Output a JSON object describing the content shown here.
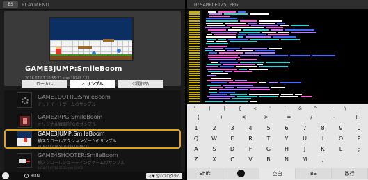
{
  "playmenu": {
    "menu_badge": "ES",
    "title": "PLAYMENU",
    "selected_game": {
      "title": "GAME3JUMP:SmileBoom",
      "meta": "2016.07.07  10:55:21   size 10748 / 21"
    },
    "tabs": [
      {
        "label": "ローカル",
        "active": false
      },
      {
        "label": "✓ サンプル",
        "active": true
      },
      {
        "label": "公開作品",
        "active": false
      }
    ],
    "list": [
      {
        "name": "GAME1DOTRC:SmileBoom",
        "desc": "ドットイートゲームのサンプル",
        "date": "2016.07.07  10:55:21  size 8120"
      },
      {
        "name": "GAME2RPG:SmileBoom",
        "desc": "オリジナル戦闘RPGのサンプル",
        "date": "2016.07.07  10:55:21  size 9841"
      },
      {
        "name": "GAME3JUMP:SmileBoom",
        "desc": "横スクロールアクションゲームのサンプル",
        "date": "2016.07.07  10:55:21  size 10748 / 21",
        "selected": true
      },
      {
        "name": "GAME4SHOOTER:SmileBoom",
        "desc": "横スクロールシューティングゲームのサンプル",
        "date": "2016.07.07  10:55:21  size 12003"
      }
    ],
    "footer": {
      "run_label": "RUN",
      "help_label": "◁ ▼ 短いプログラム"
    }
  },
  "editor": {
    "file_title": "0:SAMPLE125.PRG",
    "code_colors": {
      "comment": "#2fd3d3",
      "keyword": "#ffffff",
      "string": "#ff5fd7",
      "number": "#b27bff",
      "plain": "#3f6bff"
    }
  },
  "keyboard": {
    "symbol_row": [
      "\"",
      "(",
      "[",
      "{",
      "<",
      "'",
      "`",
      "&",
      "^",
      "|",
      "\\",
      "_"
    ],
    "symbol_row2": [
      "(",
      ")",
      "<",
      ">",
      "=",
      "/",
      "-",
      "+"
    ],
    "number_row": [
      "1",
      "2",
      "3",
      "4",
      "5",
      "6",
      "7",
      "8",
      "9",
      "0"
    ],
    "row_q": [
      "Q",
      "W",
      "E",
      "R",
      "T",
      "Y",
      "U",
      "I",
      "O",
      "P"
    ],
    "row_a": [
      "A",
      "S",
      "D",
      "F",
      "G",
      "H",
      "J",
      "K",
      "L",
      ";"
    ],
    "row_z": [
      "Z",
      "X",
      "C",
      "V",
      "B",
      "N",
      "M",
      ",",
      ".",
      ""
    ],
    "bottom": {
      "shift": "Shift",
      "space": "空白",
      "bs": "BS",
      "enter": "改行"
    }
  }
}
